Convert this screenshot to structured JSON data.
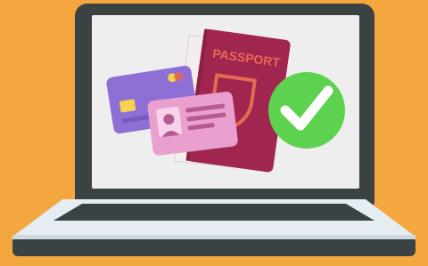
{
  "passport": {
    "title": "PASSPORT"
  },
  "colors": {
    "background": "#F4A63F",
    "laptop_frame": "#3B4243",
    "screen": "#EEEEEE",
    "passport_cover": "#A0254F",
    "passport_pages": "#F3EEEA",
    "emblem": "#E46A52",
    "check_circle": "#5DD24F",
    "credit_card": "#8D6FD6",
    "id_card": "#E9A0CE",
    "chip": "#F2D24E",
    "base_top": "#E5EDF3"
  },
  "icons": {
    "check": "check-icon",
    "emblem": "shield-emblem-icon",
    "chip": "card-chip-icon",
    "photo": "id-photo-icon",
    "card_logo": "card-logo-icon"
  }
}
